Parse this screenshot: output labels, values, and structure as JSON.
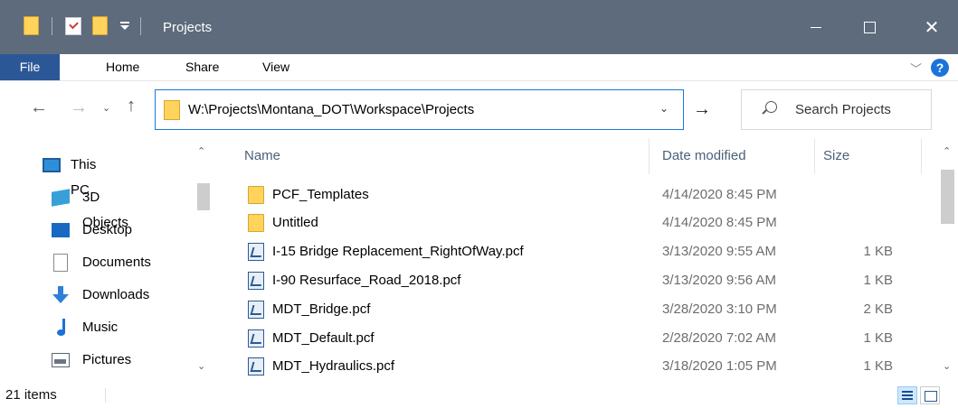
{
  "window": {
    "title": "Projects"
  },
  "ribbon": {
    "tabs": [
      "File",
      "Home",
      "Share",
      "View"
    ],
    "help": "?"
  },
  "address": {
    "path": "W:\\Projects\\Montana_DOT\\Workspace\\Projects"
  },
  "search": {
    "placeholder": "Search Projects"
  },
  "nav": {
    "items": [
      "This PC",
      "3D Objects",
      "Desktop",
      "Documents",
      "Downloads",
      "Music",
      "Pictures"
    ]
  },
  "columns": {
    "name": "Name",
    "date": "Date modified",
    "size": "Size"
  },
  "files": [
    {
      "name": "PCF_Templates",
      "date": "4/14/2020 8:45 PM",
      "size": "",
      "icon": "folder-icon"
    },
    {
      "name": "Untitled",
      "date": "4/14/2020 8:45 PM",
      "size": "",
      "icon": "folder-icon"
    },
    {
      "name": "I-15 Bridge Replacement_RightOfWay.pcf",
      "date": "3/13/2020 9:55 AM",
      "size": "1 KB",
      "icon": "pcf-file-icon"
    },
    {
      "name": "I-90 Resurface_Road_2018.pcf",
      "date": "3/13/2020 9:56 AM",
      "size": "1 KB",
      "icon": "pcf-file-icon"
    },
    {
      "name": "MDT_Bridge.pcf",
      "date": "3/28/2020 3:10 PM",
      "size": "2 KB",
      "icon": "pcf-file-icon"
    },
    {
      "name": "MDT_Default.pcf",
      "date": "2/28/2020 7:02 AM",
      "size": "1 KB",
      "icon": "pcf-file-icon"
    },
    {
      "name": "MDT_Hydraulics.pcf",
      "date": "3/18/2020 1:05 PM",
      "size": "1 KB",
      "icon": "pcf-file-icon"
    }
  ],
  "status": {
    "count": "21 items"
  },
  "colors": {
    "titlebar": "#5d6b7c",
    "file_tab": "#2b5797",
    "accent": "#1a7ad6"
  }
}
